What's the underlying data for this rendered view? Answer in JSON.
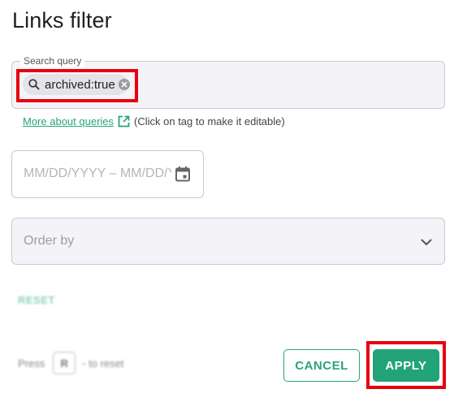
{
  "dialog": {
    "title": "Links filter"
  },
  "search": {
    "legend": "Search query",
    "chip_label": "archived:true",
    "icon": "search-icon",
    "remove_icon": "close-icon"
  },
  "helper": {
    "link_text": "More about queries",
    "link_icon": "external-link-icon",
    "note": "(Click on tag to make it editable)"
  },
  "date_range": {
    "placeholder": "MM/DD/YYYY – MM/DD/YYYY",
    "icon": "calendar-icon"
  },
  "order_by": {
    "placeholder": "Order by",
    "icon": "chevron-down-icon"
  },
  "reset": {
    "label": "RESET"
  },
  "hint": {
    "prefix": "Press",
    "key": "R",
    "suffix": "- to reset"
  },
  "actions": {
    "cancel_label": "CANCEL",
    "apply_label": "APPLY"
  },
  "colors": {
    "accent": "#22a378",
    "highlight": "#e8000d",
    "field_bg": "#f4f4f8"
  }
}
